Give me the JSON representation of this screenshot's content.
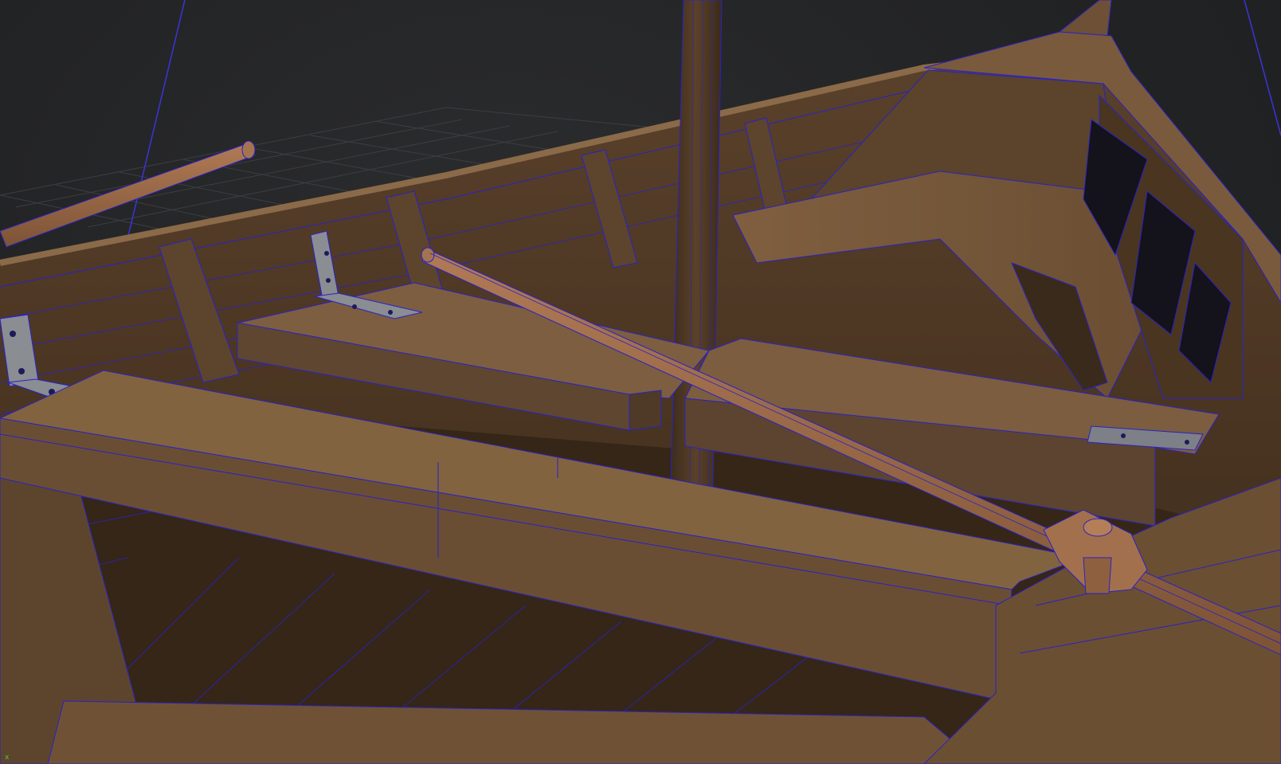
{
  "viewport": {
    "background": "#222325",
    "wireframe_color": "#2a22c8",
    "wood_color": "#6e5136",
    "hud": {
      "axis_label": "x"
    }
  },
  "objects": [
    {
      "id": "mast",
      "kind": "mast"
    },
    {
      "id": "oar-front",
      "kind": "oar"
    },
    {
      "id": "oar-back",
      "kind": "oar"
    },
    {
      "id": "bench-front",
      "kind": "thwart"
    },
    {
      "id": "bench-mid",
      "kind": "thwart"
    },
    {
      "id": "bench-rear",
      "kind": "thwart"
    },
    {
      "id": "oarlock",
      "kind": "oarlock"
    },
    {
      "id": "bow-deck",
      "kind": "deck"
    }
  ]
}
